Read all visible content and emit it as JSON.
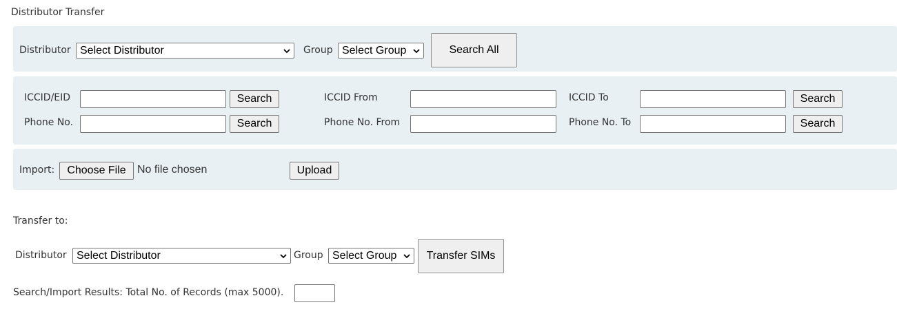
{
  "page_title": "Distributor Transfer",
  "search_panel": {
    "distributor_label": "Distributor",
    "distributor_select": "Select Distributor",
    "group_label": "Group",
    "group_select": "Select Group",
    "search_all_button": "Search All"
  },
  "range_panel": {
    "iccid_eid_label": "ICCID/EID",
    "iccid_eid_value": "",
    "iccid_search_button": "Search",
    "phone_label": "Phone No.",
    "phone_value": "",
    "phone_search_button": "Search",
    "iccid_from_label": "ICCID From",
    "iccid_from_value": "",
    "iccid_to_label": "ICCID To",
    "iccid_to_value": "",
    "iccid_range_search_button": "Search",
    "phone_from_label": "Phone No. From",
    "phone_from_value": "",
    "phone_to_label": "Phone No. To",
    "phone_to_value": "",
    "phone_range_search_button": "Search"
  },
  "import_panel": {
    "import_label": "Import:",
    "choose_file_button": "Choose File",
    "file_status": "No file chosen",
    "upload_button": "Upload"
  },
  "transfer": {
    "heading": "Transfer to:",
    "distributor_label": "Distributor",
    "distributor_select": "Select Distributor",
    "group_label": "Group",
    "group_select": "Select Group",
    "transfer_button": "Transfer SIMs"
  },
  "results": {
    "label": "Search/Import Results: Total No. of Records (max 5000).",
    "count_value": ""
  }
}
